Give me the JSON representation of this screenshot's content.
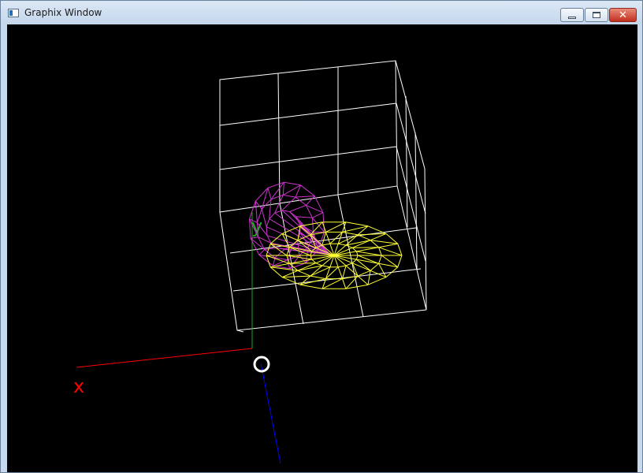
{
  "window": {
    "title": "Graphix Window",
    "buttons": {
      "minimize": "minimize",
      "maximize": "maximize",
      "close": "close"
    }
  },
  "scene": {
    "background": "#000000",
    "axes": {
      "x": {
        "label": "x",
        "color": "#ff0000"
      },
      "y": {
        "label": "y",
        "color": "#22aa22"
      },
      "z": {
        "color": "#0000ff"
      },
      "origin_marker_color": "#ffffff"
    },
    "objects": [
      {
        "name": "wireframe-cube-grid",
        "color": "#ffffff"
      },
      {
        "name": "wireframe-cone",
        "color": "#cc33cc"
      },
      {
        "name": "wireframe-disc",
        "color": "#ffff33"
      }
    ]
  }
}
